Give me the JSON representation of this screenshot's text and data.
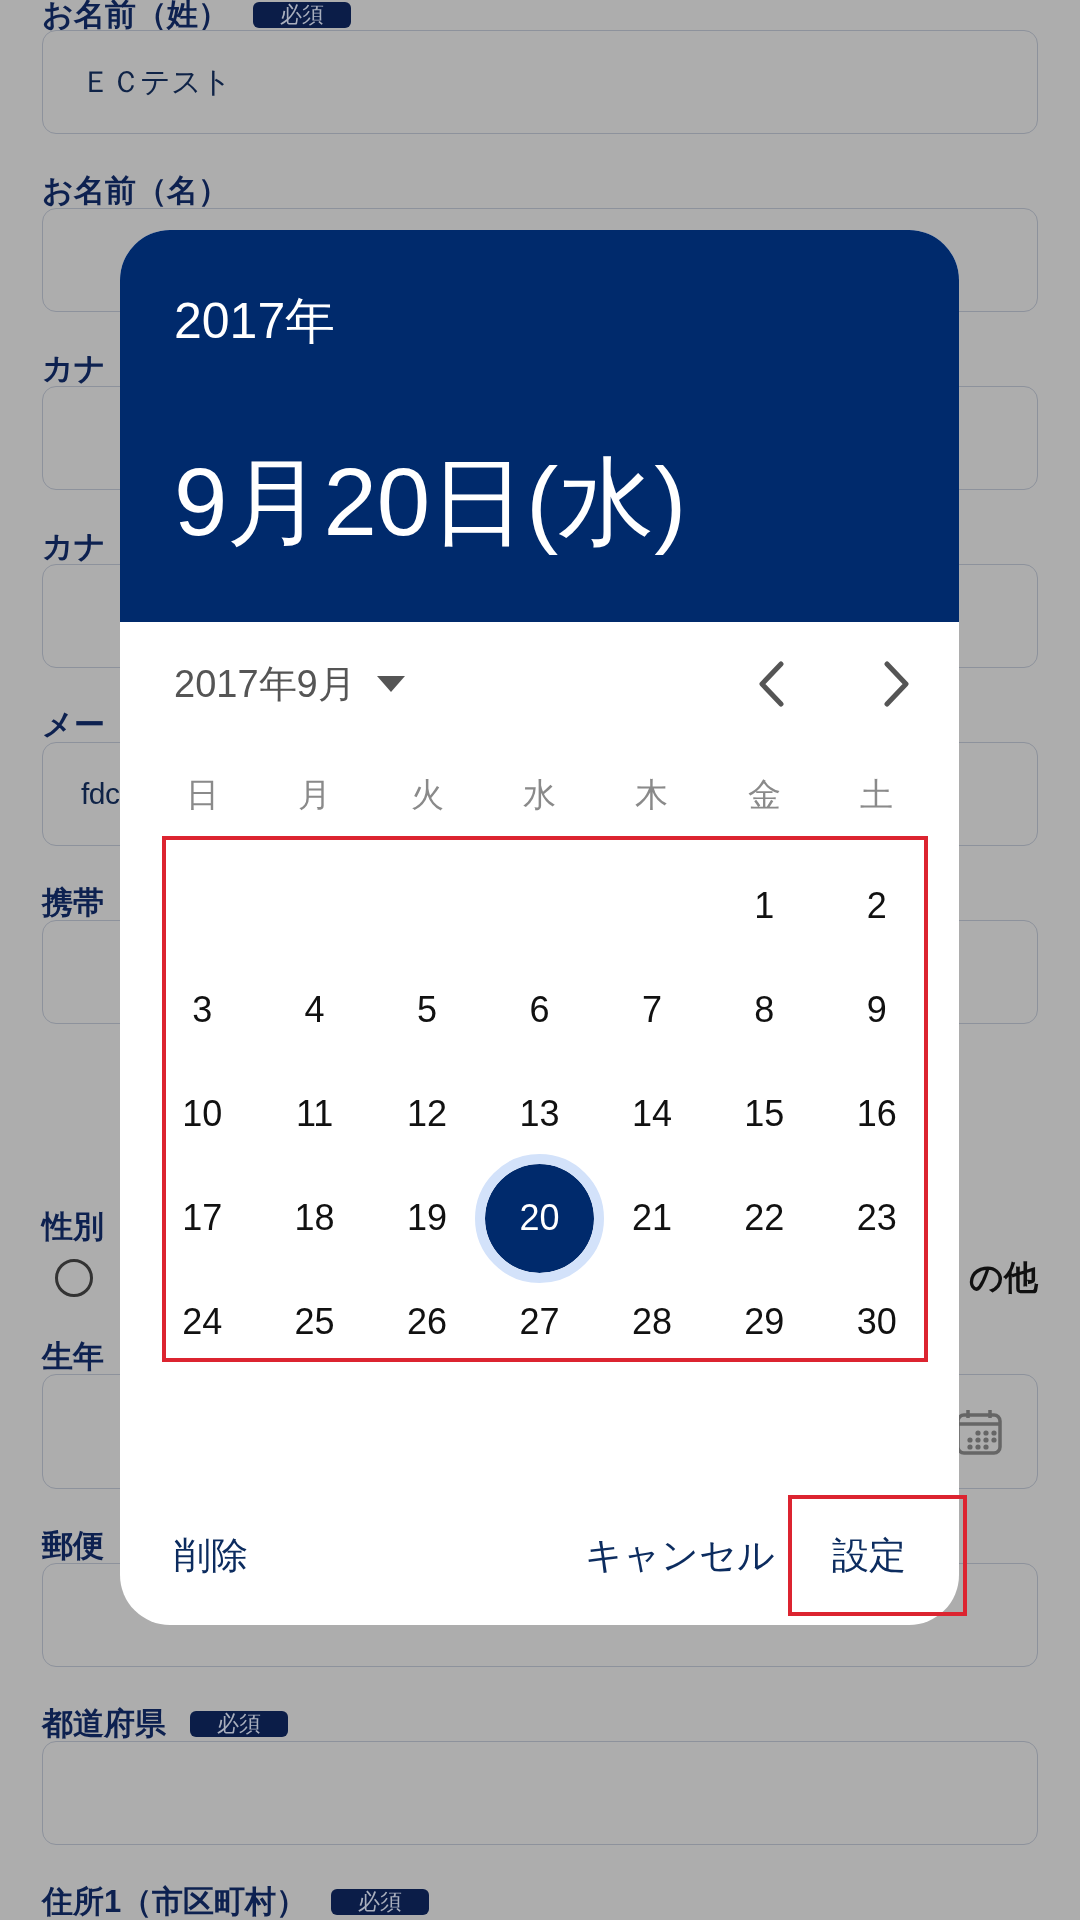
{
  "form": {
    "fields": [
      {
        "kind": "text",
        "label": "お名前（姓）",
        "badge": "必須",
        "value": "ＥＣテスト"
      },
      {
        "kind": "text",
        "label": "お名前（名）"
      },
      {
        "kind": "text",
        "label": "カナ"
      },
      {
        "kind": "text",
        "label": "カナ"
      },
      {
        "kind": "text",
        "label": "メー",
        "value": "fdc"
      },
      {
        "kind": "text",
        "label": "携帯"
      },
      {
        "kind": "radio",
        "label": "性別",
        "options": [
          {
            "selected": false
          }
        ],
        "trailing_label": "の他"
      },
      {
        "kind": "date",
        "label": "生年"
      },
      {
        "kind": "text",
        "label": "郵便"
      },
      {
        "kind": "text",
        "label": "都道府県",
        "badge": "必須"
      },
      {
        "kind": "heading",
        "label": "住所1（市区町村）",
        "badge": "必須"
      }
    ]
  },
  "calendar": {
    "year": "2017年",
    "date": "9月20日(水)",
    "month": "2017年9月",
    "weekdays": [
      "日",
      "月",
      "火",
      "水",
      "木",
      "金",
      "土"
    ],
    "weeks": [
      {
        "days": [
          {
            "label": "1",
            "selected": false
          },
          {
            "label": "2",
            "selected": false
          }
        ]
      },
      {
        "days": [
          {
            "label": "3",
            "selected": false
          },
          {
            "label": "4",
            "selected": false
          },
          {
            "label": "5",
            "selected": false
          },
          {
            "label": "6",
            "selected": false
          },
          {
            "label": "7",
            "selected": false
          },
          {
            "label": "8",
            "selected": false
          },
          {
            "label": "9",
            "selected": false
          }
        ]
      },
      {
        "days": [
          {
            "label": "10",
            "selected": false
          },
          {
            "label": "11",
            "selected": false
          },
          {
            "label": "12",
            "selected": false
          },
          {
            "label": "13",
            "selected": false
          },
          {
            "label": "14",
            "selected": false
          },
          {
            "label": "15",
            "selected": false
          },
          {
            "label": "16",
            "selected": false
          }
        ]
      },
      {
        "days": [
          {
            "label": "17",
            "selected": false
          },
          {
            "label": "18",
            "selected": false
          },
          {
            "label": "19",
            "selected": false
          },
          {
            "label": "20",
            "selected": true
          },
          {
            "label": "21",
            "selected": false
          },
          {
            "label": "22",
            "selected": false
          },
          {
            "label": "23",
            "selected": false
          }
        ]
      },
      {
        "days": [
          {
            "label": "24",
            "selected": false
          },
          {
            "label": "25",
            "selected": false
          },
          {
            "label": "26",
            "selected": false
          },
          {
            "label": "27",
            "selected": false
          },
          {
            "label": "28",
            "selected": false
          },
          {
            "label": "29",
            "selected": false
          },
          {
            "label": "30",
            "selected": false
          }
        ]
      }
    ],
    "annotated": true,
    "actions": [
      {
        "label": "削除",
        "annotated": false
      },
      {
        "label": "キャンセル",
        "annotated": false
      },
      {
        "label": "設定",
        "annotated": true
      }
    ]
  }
}
